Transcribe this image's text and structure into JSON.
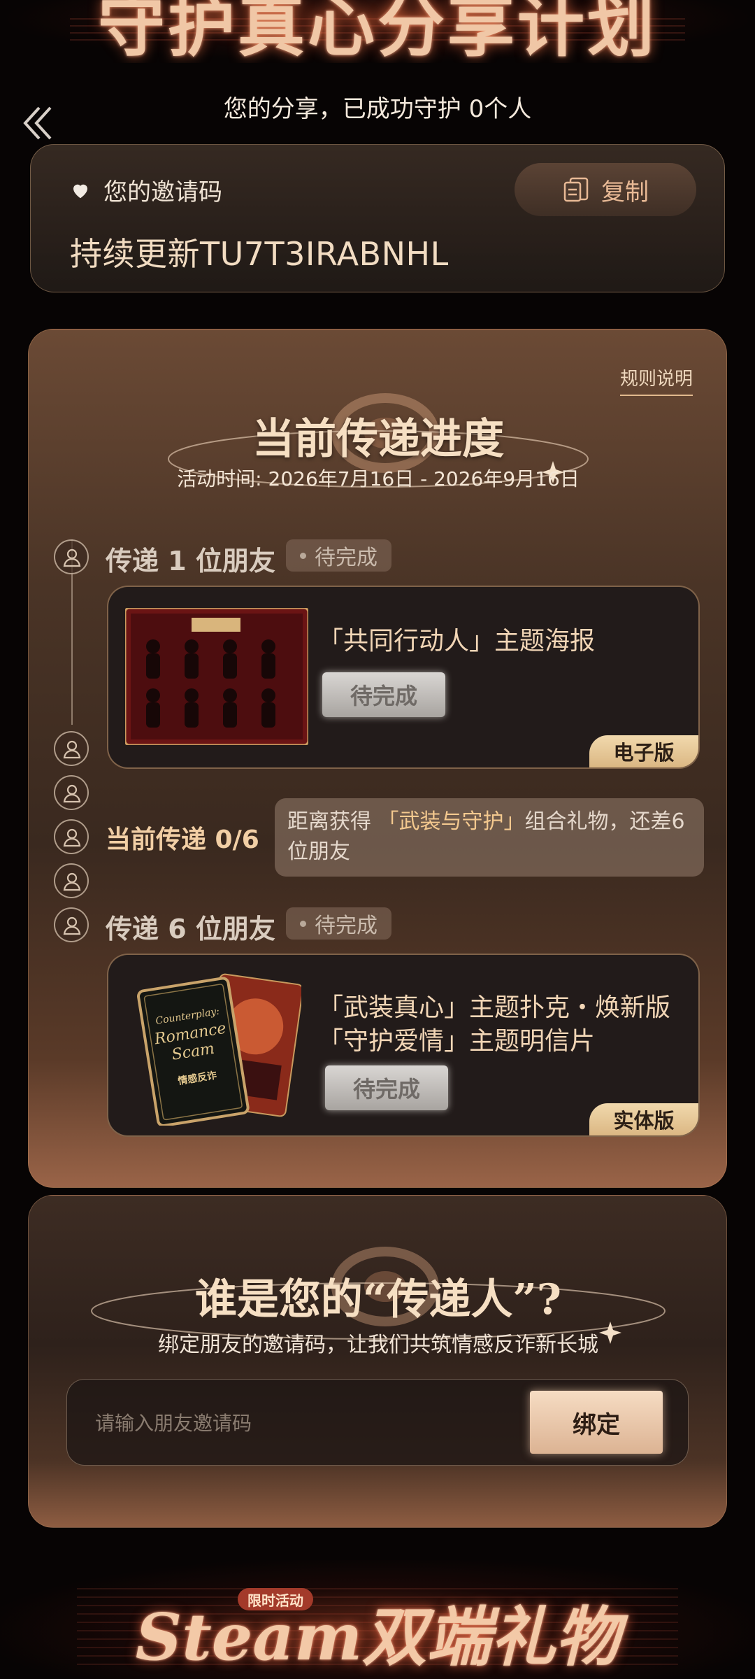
{
  "header": {
    "banner_title": "守护真心分享计划",
    "share_summary": "您的分享，已成功守护 0个人"
  },
  "invite": {
    "label": "您的邀请码",
    "copy_label": "复制",
    "code": "持续更新TU7T3IRABNHL"
  },
  "progress": {
    "rules_link": "规则说明",
    "title": "当前传递进度",
    "activity_time": "活动时间: 2026年7月16日 - 2026年9月16日",
    "steps": [
      {
        "label": "传递 1 位朋友",
        "status": "待完成",
        "reward": {
          "titles": [
            "「共同行动人」主题海报"
          ],
          "status": "待完成",
          "edition": "电子版"
        }
      },
      {
        "label": "传递 6 位朋友",
        "status": "待完成",
        "reward": {
          "titles": [
            "「武装真心」主题扑克・焕新版",
            "「守护爱情」主题明信片"
          ],
          "status": "待完成",
          "edition": "实体版"
        }
      }
    ],
    "current": {
      "label": "当前传递 0/6",
      "count": 0,
      "total": 6,
      "tip_prefix": "距离获得 ",
      "tip_highlight": "「武装与守护」",
      "tip_suffix": "组合礼物，还差6位朋友"
    },
    "poker_card": {
      "line1": "Counterplay:",
      "line2": "Romance",
      "line3": "Scam",
      "line4": "情感反诈"
    }
  },
  "binder": {
    "title": "谁是您的“传递人”?",
    "subtitle": "绑定朋友的邀请码，让我们共筑情感反诈新长城",
    "input_placeholder": "请输入朋友邀请码",
    "bind_label": "绑定"
  },
  "footer": {
    "limited_tag": "限时活动",
    "title": "Steam双端礼物"
  },
  "colors": {
    "accent": "#e8b995",
    "badge": "#dbb783",
    "page_bg": "#070404"
  }
}
